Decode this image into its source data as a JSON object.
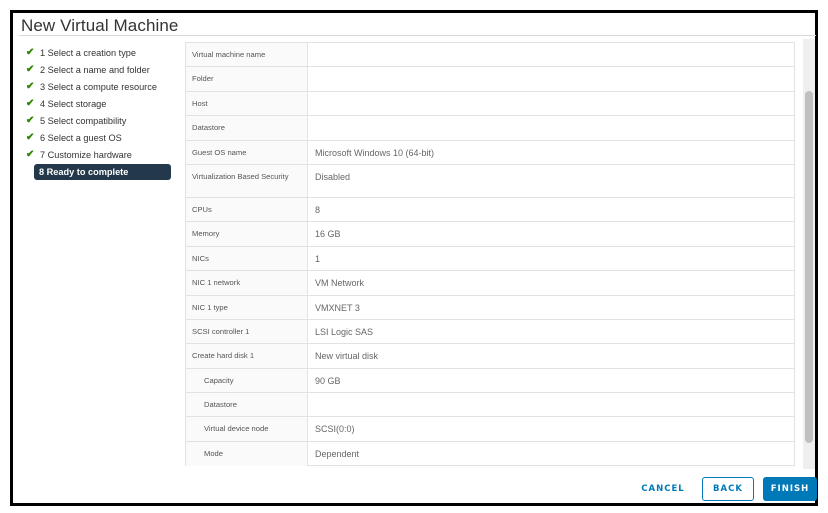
{
  "dialog": {
    "title": "New Virtual Machine"
  },
  "steps": [
    {
      "label": "1 Select a creation type",
      "status": "complete",
      "icon": "check-icon"
    },
    {
      "label": "2 Select a name and folder",
      "status": "complete",
      "icon": "check-icon"
    },
    {
      "label": "3 Select a compute resource",
      "status": "complete",
      "icon": "check-icon"
    },
    {
      "label": "4 Select storage",
      "status": "complete",
      "icon": "check-icon"
    },
    {
      "label": "5 Select compatibility",
      "status": "complete",
      "icon": "check-icon"
    },
    {
      "label": "6 Select a guest OS",
      "status": "complete",
      "icon": "check-icon"
    },
    {
      "label": "7 Customize hardware",
      "status": "complete",
      "icon": "check-icon"
    },
    {
      "label": "8 Ready to complete",
      "status": "active"
    }
  ],
  "summary": [
    {
      "key": "Virtual machine name",
      "value": ""
    },
    {
      "key": "Folder",
      "value": ""
    },
    {
      "key": "Host",
      "value": ""
    },
    {
      "key": "Datastore",
      "value": ""
    },
    {
      "key": "Guest OS name",
      "value": "Microsoft Windows 10 (64-bit)"
    },
    {
      "key": "Virtualization Based Security",
      "value": "Disabled"
    },
    {
      "key": "CPUs",
      "value": "8"
    },
    {
      "key": "Memory",
      "value": "16 GB"
    },
    {
      "key": "NICs",
      "value": "1"
    },
    {
      "key": "NIC 1 network",
      "value": "VM Network"
    },
    {
      "key": "NIC 1 type",
      "value": "VMXNET 3"
    },
    {
      "key": "SCSI controller 1",
      "value": "LSI Logic SAS"
    },
    {
      "key": "Create hard disk 1",
      "value": "New virtual disk"
    },
    {
      "key": "Capacity",
      "value": "90 GB"
    },
    {
      "key": "Datastore",
      "value": ""
    },
    {
      "key": "Virtual device node",
      "value": "SCSI(0:0)"
    },
    {
      "key": "Mode",
      "value": "Dependent"
    }
  ],
  "footer": {
    "cancel_label": "CANCEL",
    "back_label": "BACK",
    "finish_label": "FINISH"
  },
  "colors": {
    "accent": "#0079b8",
    "active_step_bg": "#23384a",
    "check": "#2f8400"
  }
}
